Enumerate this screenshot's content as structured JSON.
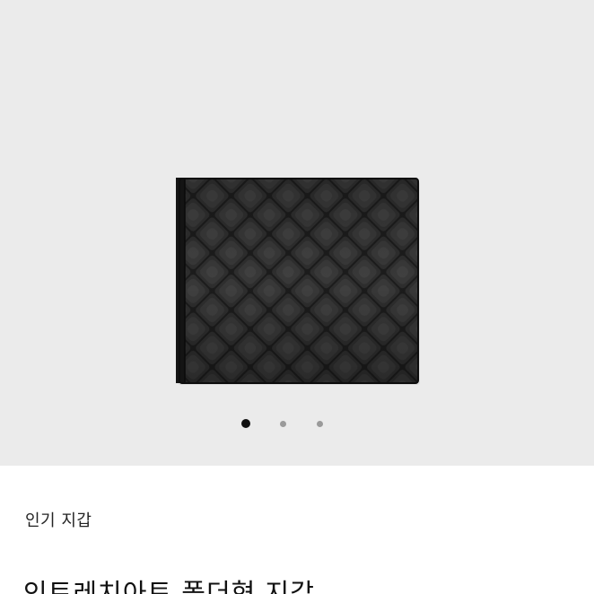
{
  "gallery": {
    "image_icon": "woven-leather-bifold-wallet",
    "slide_count": 3,
    "active_slide": 1,
    "colors": {
      "background": "#ebebeb",
      "active_dot": "#111111",
      "inactive_dot": "#9a9a9a"
    }
  },
  "product": {
    "category": "인기 지갑",
    "title": "인트레치아토 폴더형 지갑"
  }
}
